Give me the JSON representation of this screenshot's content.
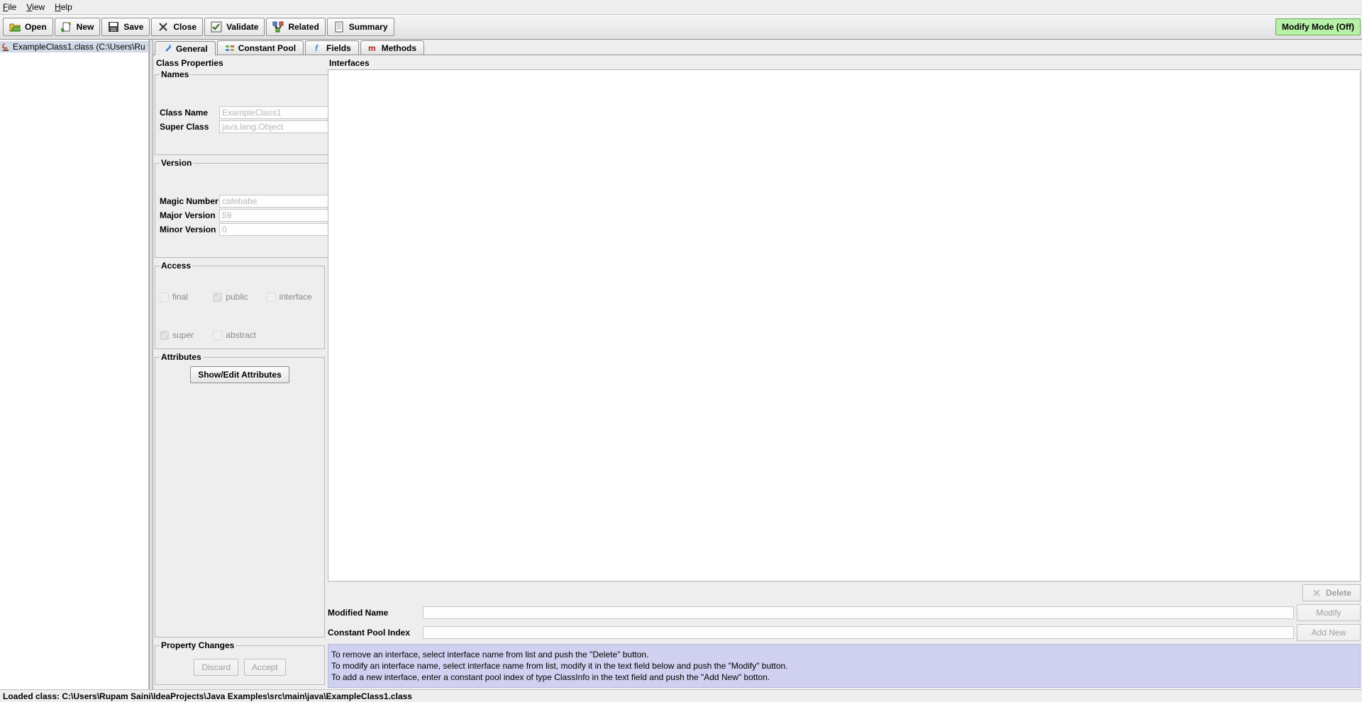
{
  "menubar": {
    "file": "File",
    "view": "View",
    "help": "Help"
  },
  "toolbar": {
    "open": "Open",
    "new": "New",
    "save": "Save",
    "close": "Close",
    "validate": "Validate",
    "related": "Related",
    "summary": "Summary",
    "modify_mode": "Modify Mode (Off)"
  },
  "tree": {
    "root": "ExampleClass1.class (C:\\Users\\Ru"
  },
  "tabs": {
    "general": "General",
    "constant_pool": "Constant Pool",
    "fields": "Fields",
    "methods": "Methods"
  },
  "class_properties": {
    "title": "Class Properties",
    "names": {
      "legend": "Names",
      "class_name_label": "Class Name",
      "class_name": "ExampleClass1",
      "super_class_label": "Super Class",
      "super_class": "java.lang.Object"
    },
    "version": {
      "legend": "Version",
      "magic_label": "Magic Number",
      "magic": "cafebabe",
      "major_label": "Major Version",
      "major": "59",
      "minor_label": "Minor Version",
      "minor": "0"
    },
    "access": {
      "legend": "Access",
      "final": "final",
      "public": "public",
      "interface": "interface",
      "super": "super",
      "abstract": "abstract"
    },
    "attributes": {
      "legend": "Attributes",
      "button": "Show/Edit Attributes"
    },
    "changes": {
      "legend": "Property Changes",
      "discard": "Discard",
      "accept": "Accept"
    }
  },
  "interfaces": {
    "title": "Interfaces",
    "delete": "Delete",
    "modified_name_label": "Modified Name",
    "modified_name": "",
    "cp_index_label": "Constant Pool Index",
    "cp_index": "",
    "modify": "Modify",
    "add_new": "Add New",
    "hint1": "To remove an interface, select interface name from list and push the \"Delete\" button.",
    "hint2": "To modify an interface name, select interface name from list, modify it in the text field below and push the \"Modify\" button.",
    "hint3": "To add a new interface, enter a constant pool index of type ClassInfo in the text field and push the \"Add New\" botton."
  },
  "statusbar": "Loaded class: C:\\Users\\Rupam Saini\\IdeaProjects\\Java Examples\\src\\main\\java\\ExampleClass1.class"
}
